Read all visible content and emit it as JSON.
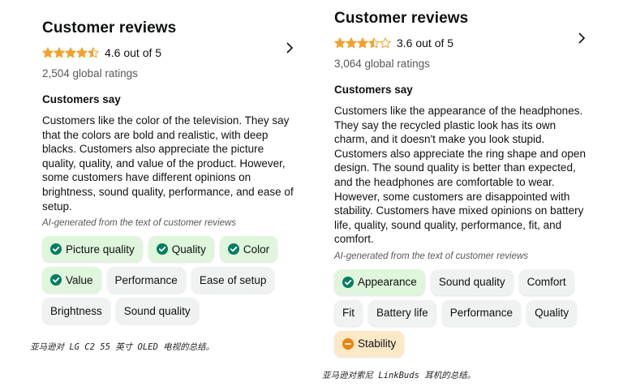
{
  "left": {
    "title": "Customer reviews",
    "rating": 4.6,
    "rating_text": "4.6 out of 5",
    "global_ratings": "2,504 global ratings",
    "customers_say": "Customers say",
    "summary": "Customers like the color of the television. They say that the colors are bold and realistic, with deep blacks. Customers also appreciate the picture quality, quality, and value of the product. However, some customers have different opinions on brightness, sound quality, performance, and ease of setup.",
    "ai_note": "AI-generated from the text of customer reviews",
    "chips": [
      {
        "label": "Picture quality",
        "sentiment": "positive"
      },
      {
        "label": "Quality",
        "sentiment": "positive"
      },
      {
        "label": "Color",
        "sentiment": "positive"
      },
      {
        "label": "Value",
        "sentiment": "positive"
      },
      {
        "label": "Performance",
        "sentiment": "neutral"
      },
      {
        "label": "Ease of setup",
        "sentiment": "neutral"
      },
      {
        "label": "Brightness",
        "sentiment": "neutral"
      },
      {
        "label": "Sound quality",
        "sentiment": "neutral"
      }
    ],
    "caption": "亚马逊对 LG C2 55 英寸 OLED 电视的总结。"
  },
  "right": {
    "title": "Customer reviews",
    "rating": 3.6,
    "rating_text": "3.6 out of 5",
    "global_ratings": "3,064 global ratings",
    "customers_say": "Customers say",
    "summary": "Customers like the appearance of the headphones. They say the recycled plastic look has its own charm, and it doesn't make you look stupid. Customers also appreciate the ring shape and open design. The sound quality is better than expected, and the headphones are comfortable to wear. However, some customers are disappointed with stability. Customers have mixed opinions on battery life, quality, sound quality, performance, fit, and comfort.",
    "ai_note": "AI-generated from the text of customer reviews",
    "chips": [
      {
        "label": "Appearance",
        "sentiment": "positive"
      },
      {
        "label": "Sound quality",
        "sentiment": "neutral"
      },
      {
        "label": "Comfort",
        "sentiment": "neutral"
      },
      {
        "label": "Fit",
        "sentiment": "neutral"
      },
      {
        "label": "Battery life",
        "sentiment": "neutral"
      },
      {
        "label": "Performance",
        "sentiment": "neutral"
      },
      {
        "label": "Quality",
        "sentiment": "neutral"
      },
      {
        "label": "Stability",
        "sentiment": "negative"
      }
    ],
    "caption": "亚马逊对索尼 LinkBuds 耳机的总结。"
  },
  "colors": {
    "star": "#f0a22e",
    "positive_icon": "#067d62",
    "negative_icon": "#e8840c"
  }
}
